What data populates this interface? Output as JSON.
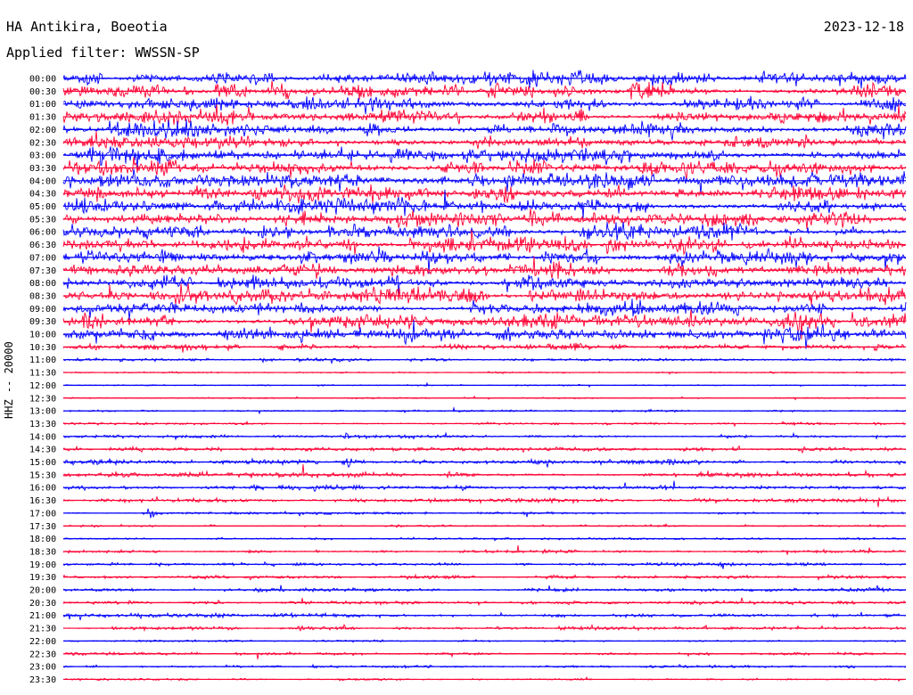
{
  "header": {
    "station": "HA Antikira, Boeotia",
    "filter": "Applied filter: WWSSN-SP",
    "date": "2023-12-18"
  },
  "chart_data": {
    "type": "line",
    "title": "HA Antikira, Boeotia",
    "subtitle": "Applied filter: WWSSN-SP",
    "date": "2023-12-18",
    "ylabel": "HHZ -- 20000",
    "row_minutes": 30,
    "colors": {
      "even": "#0000ff",
      "odd": "#ff0033"
    },
    "rows": [
      {
        "time": "00:00",
        "activity": 0.75
      },
      {
        "time": "00:30",
        "activity": 0.8
      },
      {
        "time": "01:00",
        "activity": 0.8
      },
      {
        "time": "01:30",
        "activity": 0.85
      },
      {
        "time": "02:00",
        "activity": 0.85
      },
      {
        "time": "02:30",
        "activity": 0.85
      },
      {
        "time": "03:00",
        "activity": 0.85
      },
      {
        "time": "03:30",
        "activity": 0.85
      },
      {
        "time": "04:00",
        "activity": 0.85
      },
      {
        "time": "04:30",
        "activity": 0.85
      },
      {
        "time": "05:00",
        "activity": 0.9
      },
      {
        "time": "05:30",
        "activity": 0.9
      },
      {
        "time": "06:00",
        "activity": 0.9
      },
      {
        "time": "06:30",
        "activity": 0.9
      },
      {
        "time": "07:00",
        "activity": 0.9
      },
      {
        "time": "07:30",
        "activity": 0.85
      },
      {
        "time": "08:00",
        "activity": 0.85
      },
      {
        "time": "08:30",
        "activity": 0.85
      },
      {
        "time": "09:00",
        "activity": 0.85
      },
      {
        "time": "09:30",
        "activity": 0.85
      },
      {
        "time": "10:00",
        "activity": 0.85
      },
      {
        "time": "10:30",
        "activity": 0.4
      },
      {
        "time": "11:00",
        "activity": 0.2
      },
      {
        "time": "11:30",
        "activity": 0.08
      },
      {
        "time": "12:00",
        "activity": 0.05
      },
      {
        "time": "12:30",
        "activity": 0.05
      },
      {
        "time": "13:00",
        "activity": 0.1
      },
      {
        "time": "13:30",
        "activity": 0.15
      },
      {
        "time": "14:00",
        "activity": 0.2
      },
      {
        "time": "14:30",
        "activity": 0.3
      },
      {
        "time": "15:00",
        "activity": 0.35
      },
      {
        "time": "15:30",
        "activity": 0.35
      },
      {
        "time": "16:00",
        "activity": 0.35
      },
      {
        "time": "16:30",
        "activity": 0.3
      },
      {
        "time": "17:00",
        "activity": 0.15
      },
      {
        "time": "17:30",
        "activity": 0.1
      },
      {
        "time": "18:00",
        "activity": 0.1
      },
      {
        "time": "18:30",
        "activity": 0.2
      },
      {
        "time": "19:00",
        "activity": 0.2
      },
      {
        "time": "19:30",
        "activity": 0.2
      },
      {
        "time": "20:00",
        "activity": 0.25
      },
      {
        "time": "20:30",
        "activity": 0.2
      },
      {
        "time": "21:00",
        "activity": 0.25
      },
      {
        "time": "21:30",
        "activity": 0.2
      },
      {
        "time": "22:00",
        "activity": 0.1
      },
      {
        "time": "22:30",
        "activity": 0.15
      },
      {
        "time": "23:00",
        "activity": 0.15
      },
      {
        "time": "23:30",
        "activity": 0.1
      }
    ],
    "events": [
      {
        "time": "17:00",
        "minute": 3,
        "amplitude": 1.0
      },
      {
        "time": "15:00",
        "minute": 10,
        "amplitude": 0.6
      },
      {
        "time": "14:00",
        "minute": 10,
        "amplitude": 0.5
      },
      {
        "time": "16:00",
        "minute": 14,
        "amplitude": 0.5
      },
      {
        "time": "11:00",
        "minute": 7,
        "amplitude": 0.4
      }
    ]
  }
}
